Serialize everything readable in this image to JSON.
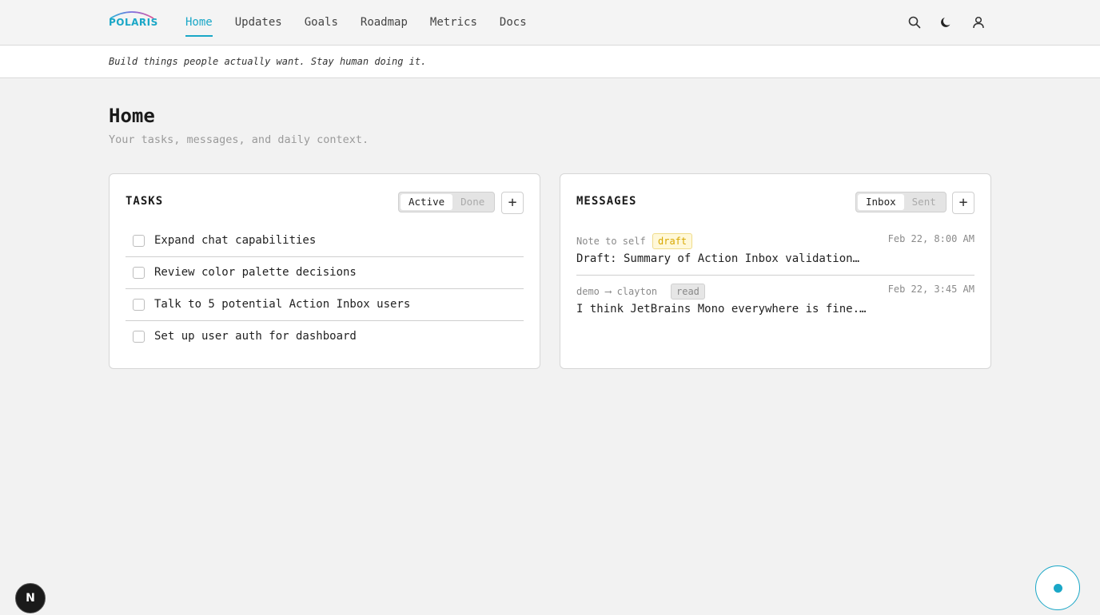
{
  "app": {
    "logo_text": "POLARIS",
    "brand_color": "#1aa7c7"
  },
  "nav": {
    "items": [
      {
        "label": "Home",
        "active": true
      },
      {
        "label": "Updates"
      },
      {
        "label": "Goals"
      },
      {
        "label": "Roadmap"
      },
      {
        "label": "Metrics"
      },
      {
        "label": "Docs"
      }
    ]
  },
  "header_icons": [
    "search-icon",
    "moon-icon",
    "user-icon"
  ],
  "tagline": "Build things people actually want. Stay human doing it.",
  "page": {
    "title": "Home",
    "subtitle": "Your tasks, messages, and daily context."
  },
  "tasks": {
    "title": "TASKS",
    "toggle": [
      "Active",
      "Done"
    ],
    "add_label": "+",
    "items": [
      {
        "label": "Expand chat capabilities",
        "done": false
      },
      {
        "label": "Review color palette decisions",
        "done": false
      },
      {
        "label": "Talk to 5 potential Action Inbox users",
        "done": false
      },
      {
        "label": "Set up user auth for dashboard",
        "done": false
      }
    ]
  },
  "messages": {
    "title": "MESSAGES",
    "toggle": [
      "Inbox",
      "Sent"
    ],
    "add_label": "+",
    "items": [
      {
        "from": "Note to self",
        "badge": "draft",
        "date": "Feb 22, 8:00 AM",
        "subject": "Draft: Summary of Action Inbox validation…"
      },
      {
        "from": "demo ⟶ clayton",
        "badge": "read",
        "date": "Feb 22, 3:45 AM",
        "subject": "I think JetBrains Mono everywhere is fine.…"
      }
    ]
  },
  "dev_badge": "N"
}
